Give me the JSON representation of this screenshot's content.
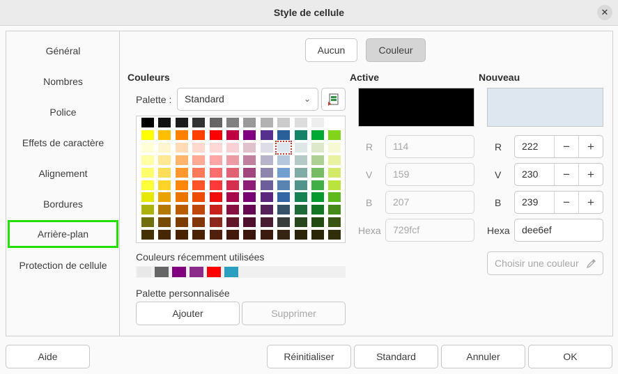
{
  "window": {
    "title": "Style de cellule",
    "close_icon": "✕"
  },
  "sidebar": {
    "items": [
      {
        "label": "Général"
      },
      {
        "label": "Nombres"
      },
      {
        "label": "Police"
      },
      {
        "label": "Effets de caractère"
      },
      {
        "label": "Alignement"
      },
      {
        "label": "Bordures"
      },
      {
        "label": "Arrière-plan",
        "active": true
      },
      {
        "label": "Protection de cellule"
      }
    ]
  },
  "mode": {
    "none_label": "Aucun",
    "color_label": "Couleur",
    "selected": "Couleur"
  },
  "colors": {
    "title": "Couleurs",
    "palette_label": "Palette :",
    "palette_value": "Standard",
    "recent_label": "Couleurs récemment utilisées",
    "recent": [
      "#e8e8e8",
      "#666666",
      "#800080",
      "#8b2c8b",
      "#ff0000",
      "#2a9fbf"
    ],
    "custom_label": "Palette personnalisée",
    "add_label": "Ajouter",
    "delete_label": "Supprimer"
  },
  "active": {
    "title": "Active",
    "color": "#000000",
    "r_label": "R",
    "r_value": "114",
    "v_label": "V",
    "v_value": "159",
    "b_label": "B",
    "b_value": "207",
    "hex_label": "Hexa",
    "hex_value": "729fcf"
  },
  "new": {
    "title": "Nouveau",
    "color": "#dee6ef",
    "r_label": "R",
    "r_value": "222",
    "v_label": "V",
    "v_value": "230",
    "b_label": "B",
    "b_value": "239",
    "hex_label": "Hexa",
    "hex_value": "dee6ef",
    "pick_label": "Choisir une couleur",
    "minus": "−",
    "plus": "+"
  },
  "footer": {
    "help_label": "Aide",
    "reset_label": "Réinitialiser",
    "standard_label": "Standard",
    "cancel_label": "Annuler",
    "ok_label": "OK"
  },
  "palette_grid": [
    [
      "#000000",
      "#111111",
      "#1c1c1c",
      "#333333",
      "#666666",
      "#808080",
      "#999999",
      "#b2b2b2",
      "#cccccc",
      "#dddddd",
      "#eeeeee",
      "#ffffff"
    ],
    [
      "#ffff00",
      "#ffbf00",
      "#ff8000",
      "#ff4000",
      "#ff0000",
      "#bf0041",
      "#800080",
      "#55308d",
      "#2a6099",
      "#158466",
      "#00a933",
      "#81d41a"
    ],
    [
      "#ffffd7",
      "#fff5ce",
      "#ffdbb6",
      "#ffd8ce",
      "#ffd7d7",
      "#f7d1d5",
      "#e0c2cd",
      "#dedce6",
      "#dee6ef",
      "#dee7e5",
      "#dde8cb",
      "#f6f9d4"
    ],
    [
      "#ffffa6",
      "#ffe994",
      "#ffb66c",
      "#ffaa95",
      "#ffa6a6",
      "#ec9ba4",
      "#bf819e",
      "#b7b3ca",
      "#b4c7dc",
      "#b3cac7",
      "#afd095",
      "#e8f2a1"
    ],
    [
      "#ffff6d",
      "#ffde59",
      "#ff972f",
      "#ff7b59",
      "#ff6d6d",
      "#e16173",
      "#a1467e",
      "#8e86ae",
      "#729fcf",
      "#81aca6",
      "#77bc65",
      "#d4ea6b"
    ],
    [
      "#ffff38",
      "#ffd428",
      "#ff860d",
      "#ff5429",
      "#ff3838",
      "#d62e4e",
      "#8d1d75",
      "#6b5e9b",
      "#5983b0",
      "#50938a",
      "#3faf46",
      "#bbe33d"
    ],
    [
      "#e6e905",
      "#e8a202",
      "#ea7500",
      "#ed4c05",
      "#f10d0c",
      "#a7074b",
      "#780373",
      "#5b277d",
      "#3465a4",
      "#168253",
      "#069a2e",
      "#5eb91e"
    ],
    [
      "#acb20c",
      "#b47804",
      "#b85c00",
      "#be480a",
      "#c9211e",
      "#861141",
      "#650953",
      "#55215b",
      "#355269",
      "#1e6a39",
      "#127622",
      "#468a1a"
    ],
    [
      "#706e0c",
      "#784b04",
      "#7b3d00",
      "#813709",
      "#8d281e",
      "#611729",
      "#4e102d",
      "#481d32",
      "#383d3c",
      "#28471f",
      "#224b12",
      "#395511"
    ],
    [
      "#443205",
      "#472702",
      "#492300",
      "#4b2204",
      "#50200c",
      "#41190d",
      "#3b160e",
      "#3a1a0f",
      "#362413",
      "#2b2609",
      "#2a260a",
      "#302e0b"
    ]
  ]
}
